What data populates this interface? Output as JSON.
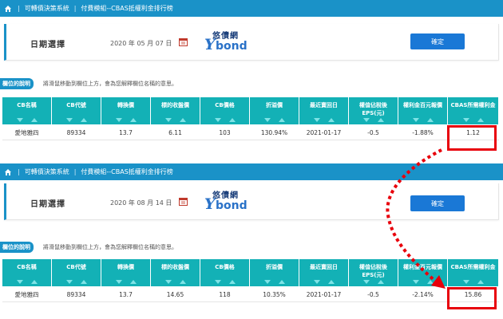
{
  "panels": [
    {
      "breadcrumb": [
        "可轉債決策系統",
        "付費模組--CBAS抵權利金排行榜"
      ],
      "date_label": "日期選擇",
      "date_value": "2020 年 05 月 07 日",
      "logo_cn": "悠債網",
      "logo_y": "Y",
      "logo_bond": "bond",
      "confirm_label": "確定",
      "desc_tag": "欄位的說明",
      "desc_text": "將滑鼠移動到欄位上方，會為您解釋欄位名稱的意思。",
      "columns": [
        "CB名稱",
        "CB代號",
        "轉換價",
        "標的收盤價",
        "CB價格",
        "折溢價",
        "最近賣回日",
        "權值佔稅後EPS(元)",
        "權利金百元報價",
        "CBAS所需權利金"
      ],
      "row": [
        "愛地雅四",
        "89334",
        "13.7",
        "6.11",
        "103",
        "130.94%",
        "2021-01-17",
        "-0.5",
        "-1.88%",
        "1.12"
      ]
    },
    {
      "breadcrumb": [
        "可轉債決策系統",
        "付費模組--CBAS抵權利金排行榜"
      ],
      "date_label": "日期選擇",
      "date_value": "2020 年 08 月 14 日",
      "logo_cn": "悠債網",
      "logo_y": "Y",
      "logo_bond": "bond",
      "confirm_label": "確定",
      "desc_tag": "欄位的說明",
      "desc_text": "將滑鼠移動到欄位上方，會為您解釋欄位名稱的意思。",
      "columns": [
        "CB名稱",
        "CB代號",
        "轉換價",
        "標的收盤價",
        "CB價格",
        "折溢價",
        "最近賣回日",
        "權值佔稅後EPS(元)",
        "權利金百元報價",
        "CBAS所需權利金"
      ],
      "row": [
        "愛地雅四",
        "89334",
        "13.7",
        "14.65",
        "118",
        "10.35%",
        "2021-01-17",
        "-0.5",
        "-2.14%",
        "15.86"
      ]
    }
  ],
  "colors": {
    "topbar": "#1a92c8",
    "header": "#13b1b6",
    "highlight": "#e8000b",
    "confirm": "#1a78d6"
  },
  "icons": [
    "home-icon",
    "calendar-icon",
    "sort-down-icon",
    "sort-up-icon",
    "dotted-arrow"
  ]
}
